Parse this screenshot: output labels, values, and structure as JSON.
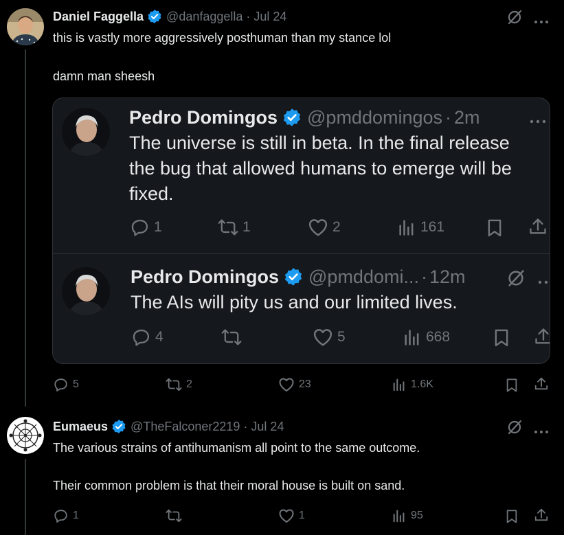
{
  "tweet1": {
    "name": "Daniel Faggella",
    "handle": "@danfaggella",
    "sep": "·",
    "date": "Jul 24",
    "line1": "this is vastly more aggressively posthuman than my stance lol",
    "line2": "damn man sheesh",
    "replies": "5",
    "reposts": "2",
    "likes": "23",
    "views": "1.6K"
  },
  "quote": {
    "post1": {
      "name": "Pedro Domingos",
      "handle": "@pmddomingos",
      "sep": "·",
      "time": "2m",
      "line1": "The universe is still in beta. In the final release",
      "line2": "the bug that allowed humans to emerge will be",
      "line3": "fixed.",
      "replies": "1",
      "reposts": "1",
      "likes": "2",
      "views": "161"
    },
    "post2": {
      "name": "Pedro Domingos",
      "handle": "@pmddomi...",
      "sep": "·",
      "time": "12m",
      "text": "The AIs will pity us and our limited lives.",
      "replies": "4",
      "likes": "5",
      "views": "668"
    }
  },
  "tweet2": {
    "name": "Eumaeus",
    "handle": "@TheFalconer2219",
    "sep": "·",
    "date": "Jul 24",
    "line1": "The various strains of antihumanism all point to the same outcome.",
    "line2": "Their common problem is that their moral house is built on sand.",
    "replies": "1",
    "likes": "1",
    "views": "95"
  },
  "colors": {
    "background": "#000000",
    "text": "#e7e9ea",
    "muted": "#71767b",
    "verified": "#1d9bf0",
    "card": "#15181c",
    "border": "#2f3336"
  }
}
